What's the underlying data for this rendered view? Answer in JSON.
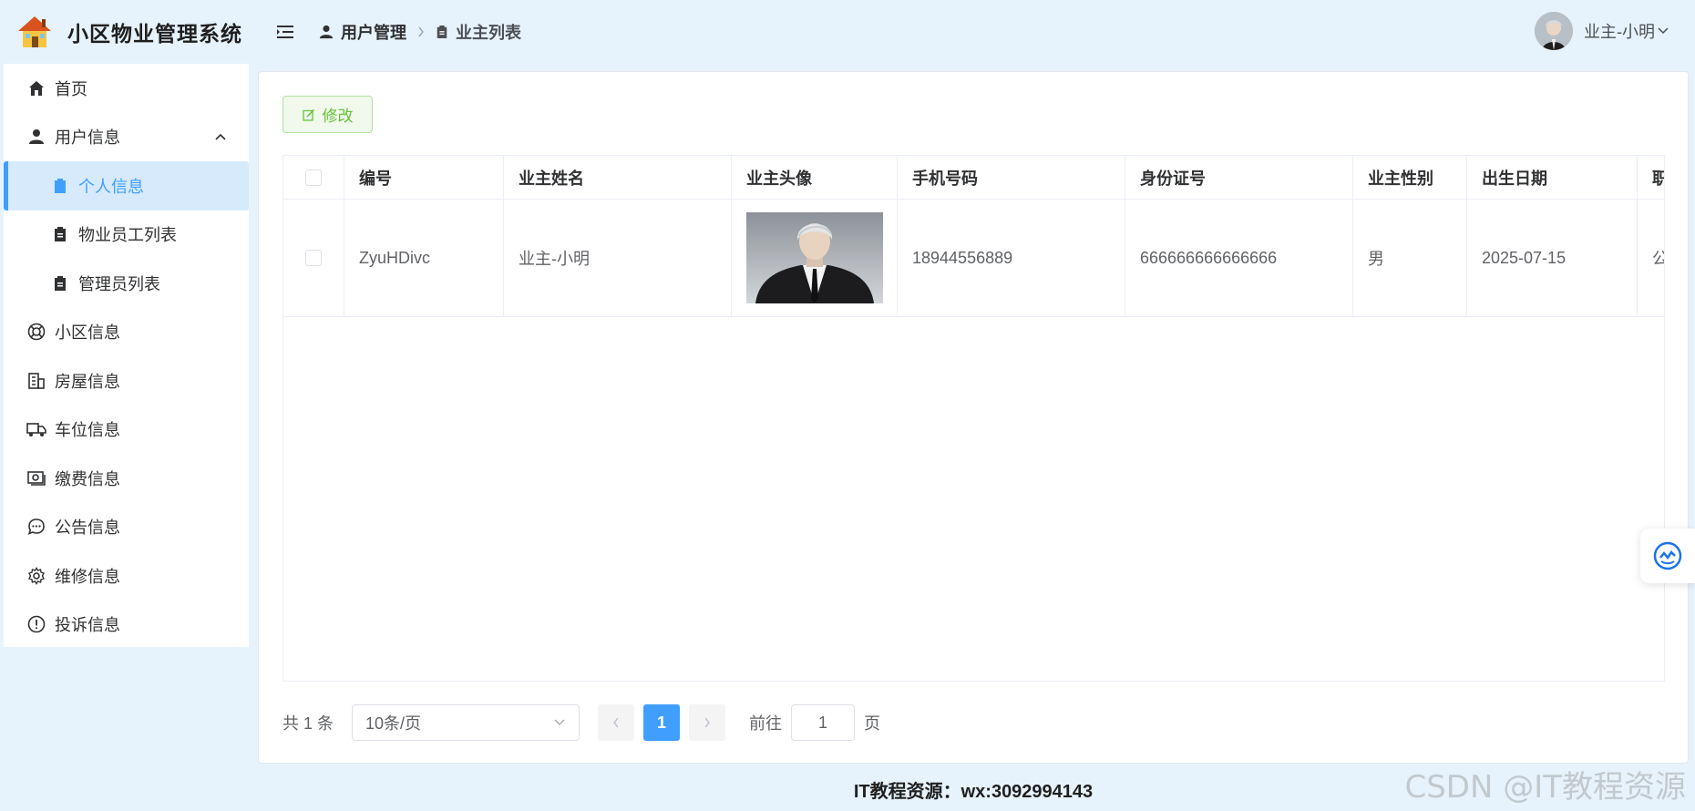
{
  "app": {
    "title": "小区物业管理系统"
  },
  "sidebar": {
    "items": [
      {
        "label": "首页",
        "icon": "home-icon"
      },
      {
        "label": "用户信息",
        "icon": "user-icon"
      },
      {
        "label": "个人信息",
        "icon": "clipboard-icon"
      },
      {
        "label": "物业员工列表",
        "icon": "clipboard-icon"
      },
      {
        "label": "管理员列表",
        "icon": "clipboard-icon"
      },
      {
        "label": "小区信息",
        "icon": "lifebuoy-icon"
      },
      {
        "label": "房屋信息",
        "icon": "building-icon"
      },
      {
        "label": "车位信息",
        "icon": "truck-icon"
      },
      {
        "label": "缴费信息",
        "icon": "money-icon"
      },
      {
        "label": "公告信息",
        "icon": "chat-icon"
      },
      {
        "label": "维修信息",
        "icon": "gear-icon"
      },
      {
        "label": "投诉信息",
        "icon": "warning-icon"
      }
    ]
  },
  "header": {
    "breadcrumb": [
      "用户管理",
      "业主列表"
    ],
    "user_name": "业主-小明"
  },
  "toolbar": {
    "edit_label": "修改"
  },
  "table": {
    "columns": [
      "编号",
      "业主姓名",
      "业主头像",
      "手机号码",
      "身份证号",
      "业主性别",
      "出生日期",
      "职"
    ],
    "rows": [
      {
        "id": "ZyuHDivc",
        "name": "业主-小明",
        "phone": "18944556889",
        "id_card": "666666666666666",
        "gender": "男",
        "birth": "2025-07-15",
        "job": "公"
      }
    ]
  },
  "pagination": {
    "total": "共 1 条",
    "page_size": "10条/页",
    "current": "1",
    "goto_label": "前往",
    "goto_value": "1",
    "page_unit": "页"
  },
  "footer": {
    "text": "IT教程资源：wx:3092994143"
  },
  "watermark": "CSDN @IT教程资源",
  "colors": {
    "accent": "#409eff",
    "success": "#67c23a",
    "background": "#e6f3fc"
  }
}
